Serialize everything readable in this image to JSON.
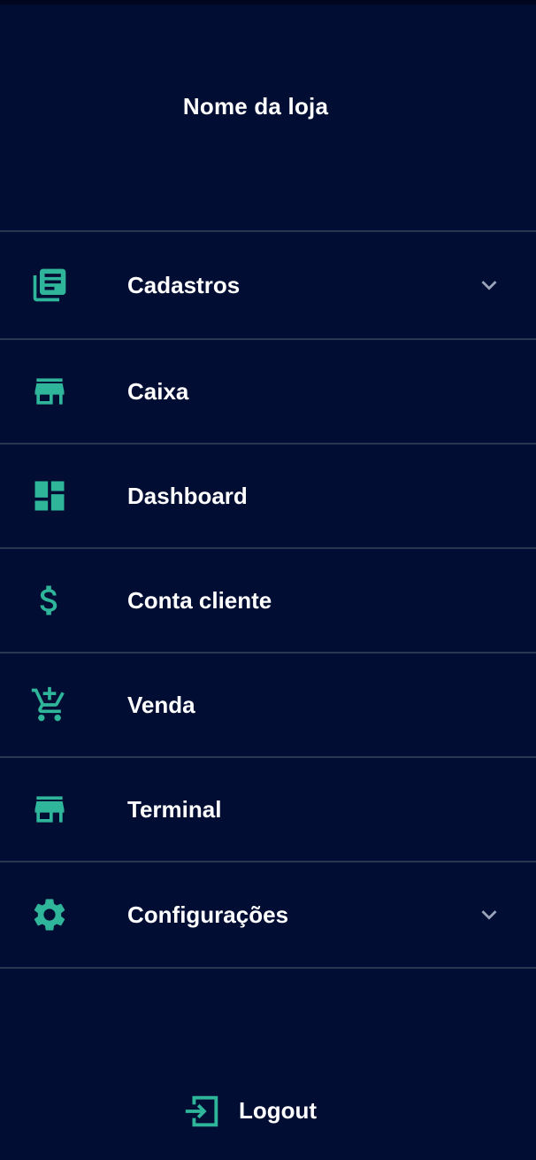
{
  "header": {
    "store_name": "Nome da loja"
  },
  "menu": {
    "items": [
      {
        "label": "Cadastros",
        "icon": "list-document-icon",
        "expandable": true
      },
      {
        "label": "Caixa",
        "icon": "store-icon",
        "expandable": false
      },
      {
        "label": "Dashboard",
        "icon": "dashboard-icon",
        "expandable": false
      },
      {
        "label": "Conta cliente",
        "icon": "dollar-icon",
        "expandable": false
      },
      {
        "label": "Venda",
        "icon": "add-shopping-cart-icon",
        "expandable": false
      },
      {
        "label": "Terminal",
        "icon": "store-icon",
        "expandable": false
      },
      {
        "label": "Configurações",
        "icon": "gear-icon",
        "expandable": true
      }
    ]
  },
  "footer": {
    "logout_label": "Logout",
    "logout_icon": "logout-icon"
  },
  "colors": {
    "background": "#010d33",
    "accent": "#2fb59a",
    "divider": "#2b3653",
    "text": "#ffffff",
    "chevron": "#9aa3b8"
  }
}
